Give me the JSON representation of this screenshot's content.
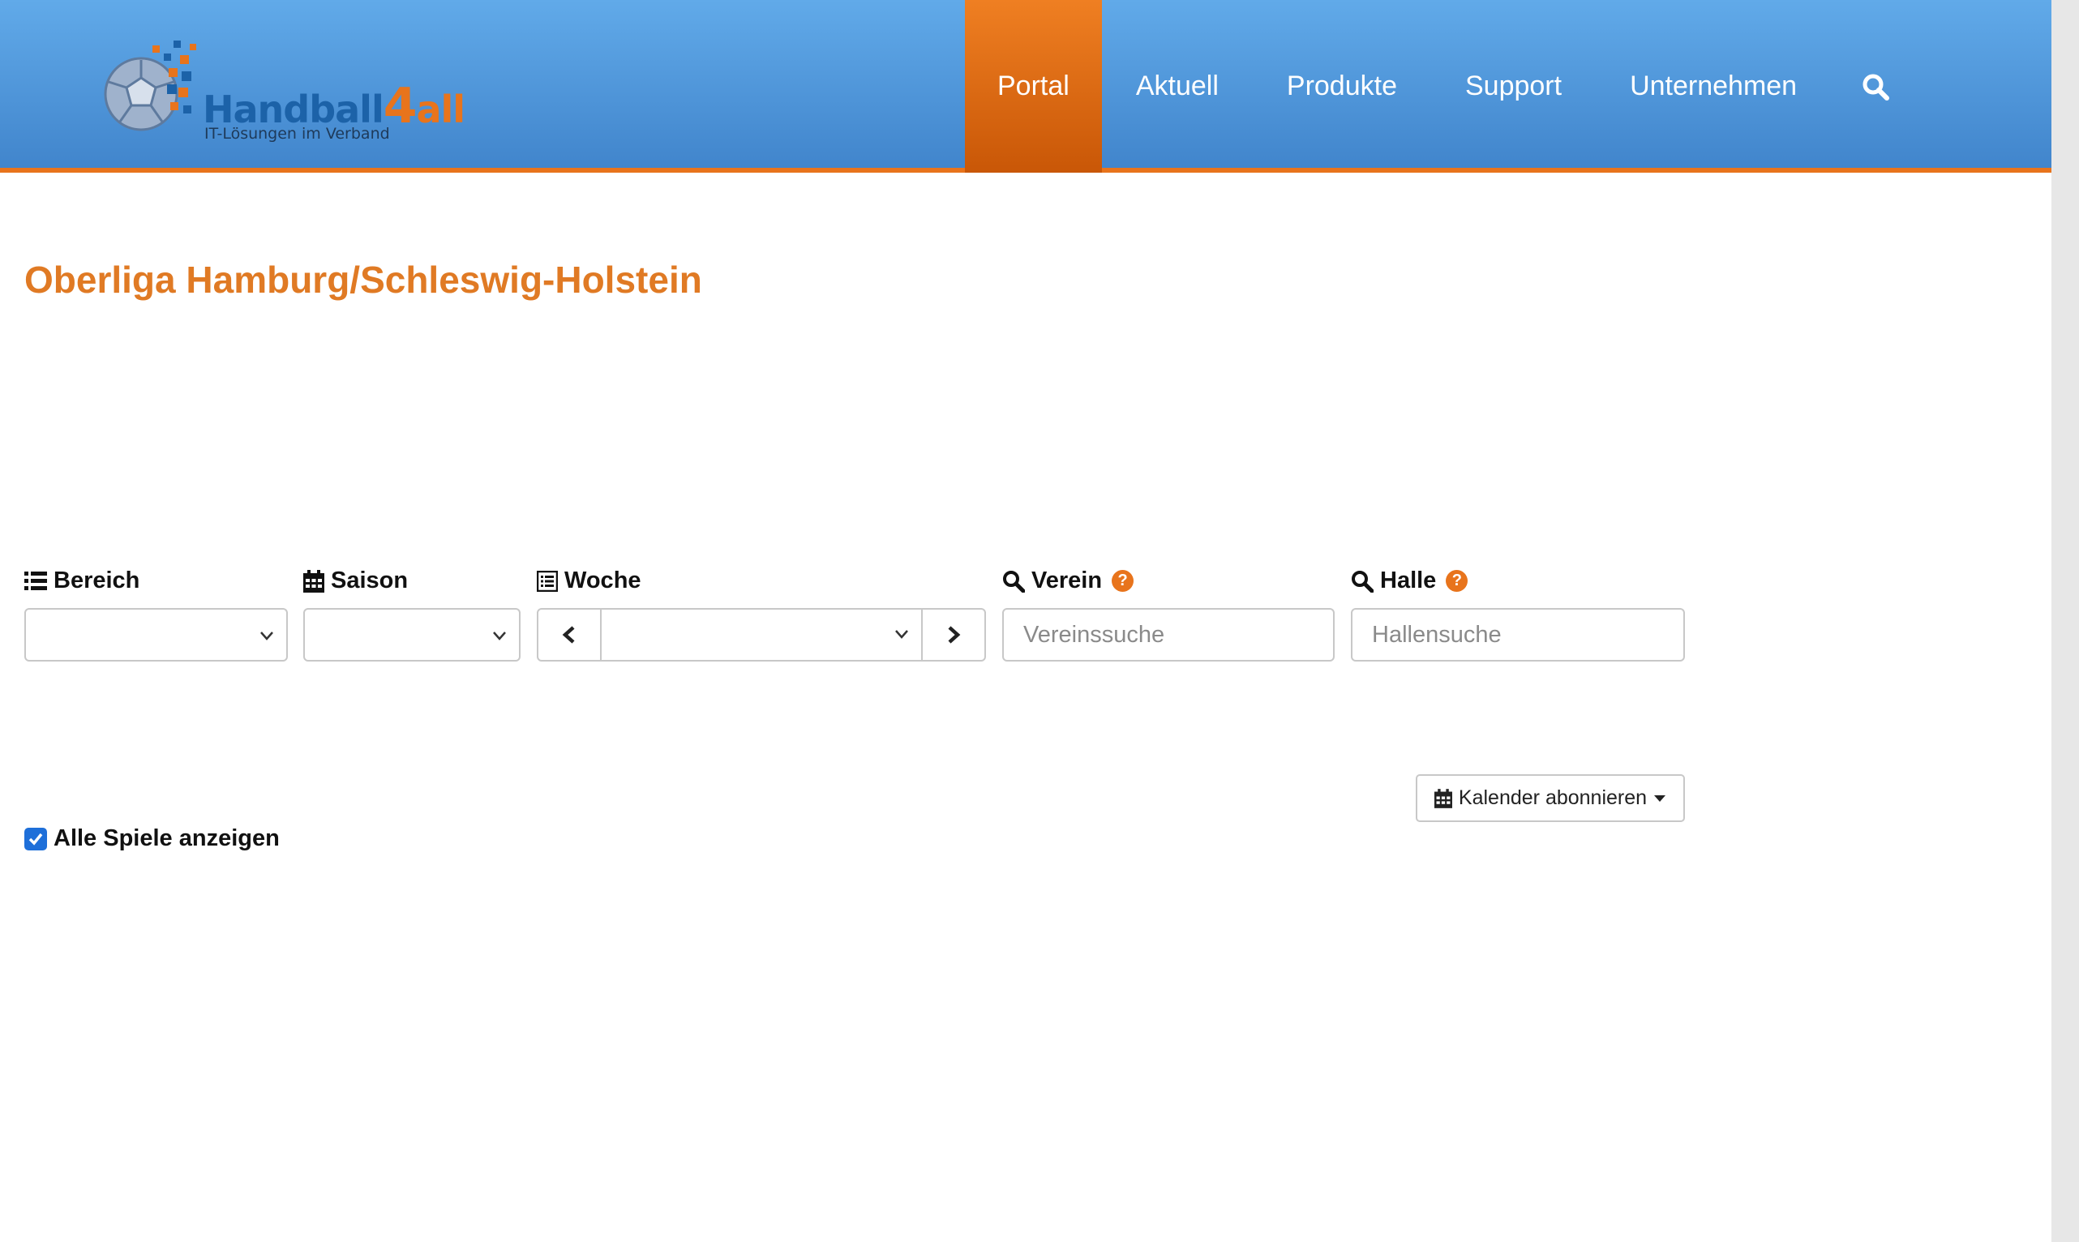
{
  "header": {
    "logo": {
      "brand": "Handball",
      "brand_number": "4",
      "brand_suffix": "all",
      "tagline": "IT-Lösungen im Verband"
    },
    "nav": [
      {
        "label": "Portal",
        "active": true
      },
      {
        "label": "Aktuell",
        "active": false
      },
      {
        "label": "Produkte",
        "active": false
      },
      {
        "label": "Support",
        "active": false
      },
      {
        "label": "Unternehmen",
        "active": false
      }
    ],
    "search_icon": "search-icon"
  },
  "main": {
    "title": "Oberliga Hamburg/Schleswig-Holstein",
    "filters": {
      "bereich": {
        "label": "Bereich",
        "icon": "list-icon",
        "value": ""
      },
      "saison": {
        "label": "Saison",
        "icon": "calendar-icon",
        "value": ""
      },
      "woche": {
        "label": "Woche",
        "icon": "week-list-icon",
        "value": ""
      },
      "verein": {
        "label": "Verein",
        "icon": "search-icon",
        "help": "?",
        "placeholder": "Vereinssuche",
        "value": ""
      },
      "halle": {
        "label": "Halle",
        "icon": "search-icon",
        "help": "?",
        "placeholder": "Hallensuche",
        "value": ""
      }
    },
    "calendar_button": {
      "label": "Kalender abonnieren",
      "icon": "calendar-icon"
    },
    "show_all": {
      "label": "Alle Spiele anzeigen",
      "checked": true
    }
  },
  "colors": {
    "header_top": "#61aae9",
    "header_bottom": "#4185cc",
    "accent_orange": "#e8741c",
    "title_orange": "#e07a24",
    "checkbox_blue": "#1e6fd9"
  }
}
